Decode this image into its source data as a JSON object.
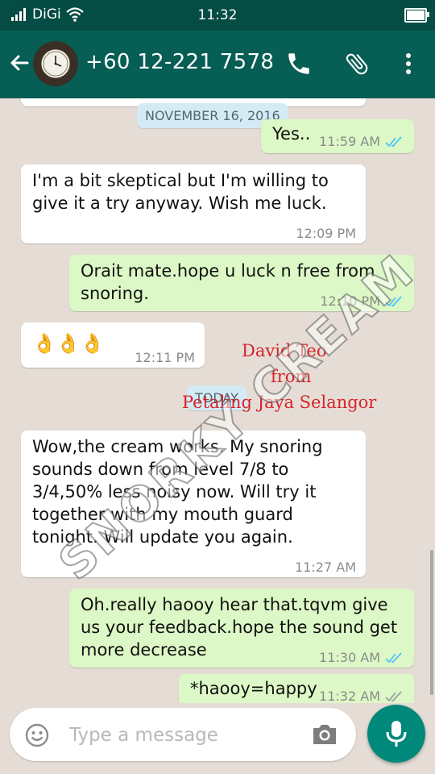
{
  "status_bar": {
    "carrier": "DiGi",
    "time": "11:32"
  },
  "header": {
    "contact": "+60 12-221 7578",
    "avatar_icon": "clock-avatar"
  },
  "date_separators": {
    "first": "NOVEMBER 16, 2016",
    "today": "TODAY"
  },
  "messages": [
    {
      "from": "me",
      "text": "Yes..",
      "time": "11:59 AM",
      "status": "read"
    },
    {
      "from": "them",
      "text": [
        "I'm a bit skeptical but I'm willing to",
        "give it a try anyway. Wish me luck."
      ],
      "time": "12:09 PM"
    },
    {
      "from": "me",
      "text": [
        "Orait mate.hope u luck n free from",
        "snoring."
      ],
      "time": "12:10 PM",
      "status": "read"
    },
    {
      "from": "them",
      "text": "👌👌👌",
      "time": "12:11 PM"
    },
    {
      "from": "them",
      "text": [
        "Wow,the cream works. My snoring",
        "sounds down from level 7/8 to",
        "3/4,50% less noisy now. Will try it",
        "together with my mouth guard",
        "tonight. Will update you again."
      ],
      "time": "11:27 AM"
    },
    {
      "from": "me",
      "text": [
        "Oh.really haooy hear that.tqvm give",
        "us your feedback.hope the sound get",
        "more decrease"
      ],
      "time": "11:30 AM",
      "status": "read"
    },
    {
      "from": "me",
      "text": "*haooy=happy",
      "time": "11:32 AM",
      "status": "delivered"
    }
  ],
  "overlay": {
    "line1": "David Teo",
    "line2": "from",
    "line3": "Petaling Jaya Selangor"
  },
  "watermark": "SNORKY CREAM",
  "composer": {
    "placeholder": "Type a message"
  },
  "colors": {
    "header": "#075e54",
    "status_bar": "#054d44",
    "outgoing": "#dcf8c6",
    "incoming": "#ffffff",
    "read_tick": "#4fc3f7",
    "accent": "#00897b"
  }
}
